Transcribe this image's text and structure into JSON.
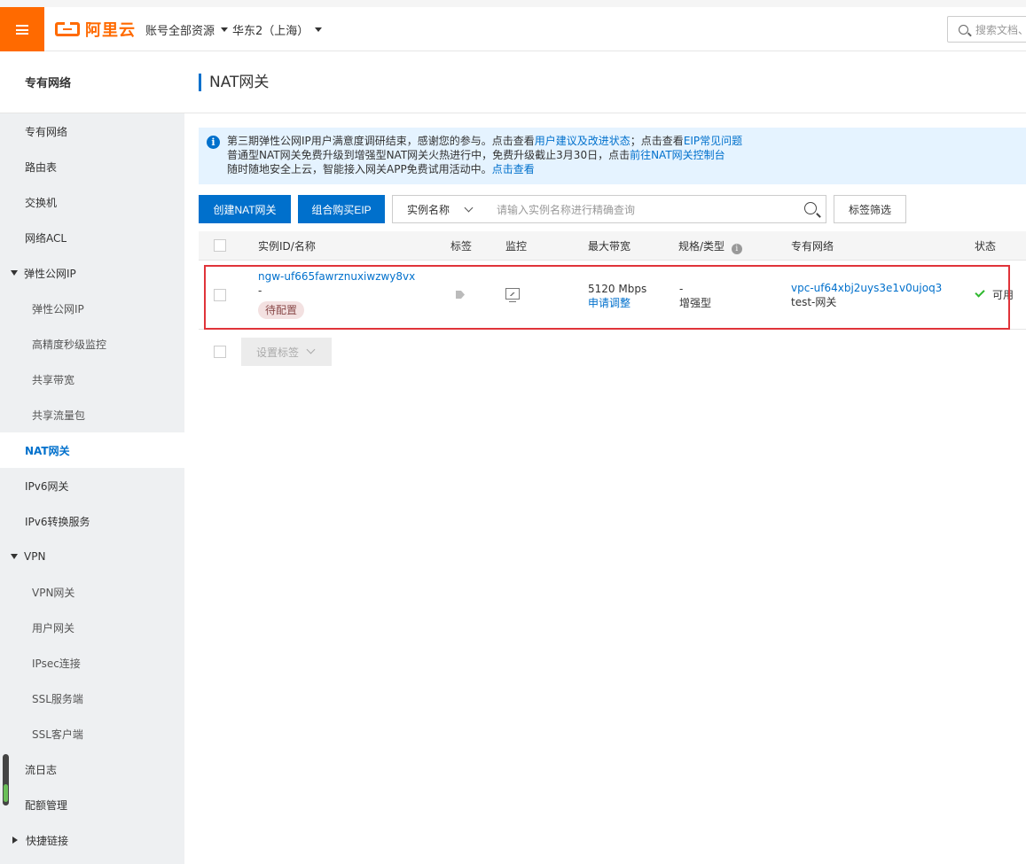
{
  "topbar": {
    "logo_text": "阿里云",
    "account_dropdown": "账号全部资源",
    "region_dropdown": "华东2（上海）",
    "search_placeholder": "搜索文档、"
  },
  "sidebar": {
    "title": "专有网络",
    "items": [
      {
        "label": "专有网络",
        "level": 1
      },
      {
        "label": "路由表",
        "level": 1
      },
      {
        "label": "交换机",
        "level": 1
      },
      {
        "label": "网络ACL",
        "level": 1
      },
      {
        "label": "弹性公网IP",
        "level": 0,
        "expanded": true
      },
      {
        "label": "弹性公网IP",
        "level": 2
      },
      {
        "label": "高精度秒级监控",
        "level": 2
      },
      {
        "label": "共享带宽",
        "level": 2
      },
      {
        "label": "共享流量包",
        "level": 2
      },
      {
        "label": "NAT网关",
        "level": 1,
        "active": true
      },
      {
        "label": "IPv6网关",
        "level": 1
      },
      {
        "label": "IPv6转换服务",
        "level": 1
      },
      {
        "label": "VPN",
        "level": 0,
        "expanded": true
      },
      {
        "label": "VPN网关",
        "level": 2
      },
      {
        "label": "用户网关",
        "level": 2
      },
      {
        "label": "IPsec连接",
        "level": 2
      },
      {
        "label": "SSL服务端",
        "level": 2
      },
      {
        "label": "SSL客户端",
        "level": 2
      },
      {
        "label": "流日志",
        "level": 1
      },
      {
        "label": "配额管理",
        "level": 1
      },
      {
        "label": "快捷链接",
        "level": 0,
        "expanded": false
      }
    ]
  },
  "page": {
    "title": "NAT网关"
  },
  "notice": {
    "line1_text": "第三期弹性公网IP用户满意度调研结束，感谢您的参与。点击查看",
    "line1_link1": "用户建议及改进状态",
    "line1_mid": "；点击查看",
    "line1_link2": "EIP常见问题",
    "line2_text": "普通型NAT网关免费升级到增强型NAT网关火热进行中，免费升级截止3月30日，点击",
    "line2_link": "前往NAT网关控制台",
    "line3_text": "随时随地安全上云，智能接入网关APP免费试用活动中。",
    "line3_link": "点击查看"
  },
  "toolbar": {
    "create_button": "创建NAT网关",
    "combo_button": "组合购买EIP",
    "filter_select": "实例名称",
    "query_placeholder": "请输入实例名称进行精确查询",
    "tag_filter_button": "标签筛选"
  },
  "table": {
    "headers": {
      "id_name": "实例ID/名称",
      "tags": "标签",
      "monitor": "监控",
      "bandwidth": "最大带宽",
      "spec": "规格/类型",
      "vpc": "专有网络",
      "status": "状态"
    },
    "rows": [
      {
        "id": "ngw-uf665fawrznuxiwzwy8vx",
        "name": "-",
        "badge": "待配置",
        "bandwidth": "5120 Mbps",
        "bandwidth_link": "申请调整",
        "spec": "-",
        "type": "增强型",
        "vpc_id": "vpc-uf64xbj2uys3e1v0ujoq3",
        "vpc_name": "test-网关",
        "status": "可用"
      }
    ]
  },
  "footer": {
    "set_tags_button": "设置标签"
  },
  "colors": {
    "brand": "#ff6a00",
    "primary": "#0070cc",
    "highlight_border": "#e0343a",
    "status_ok": "#2eb82e"
  }
}
